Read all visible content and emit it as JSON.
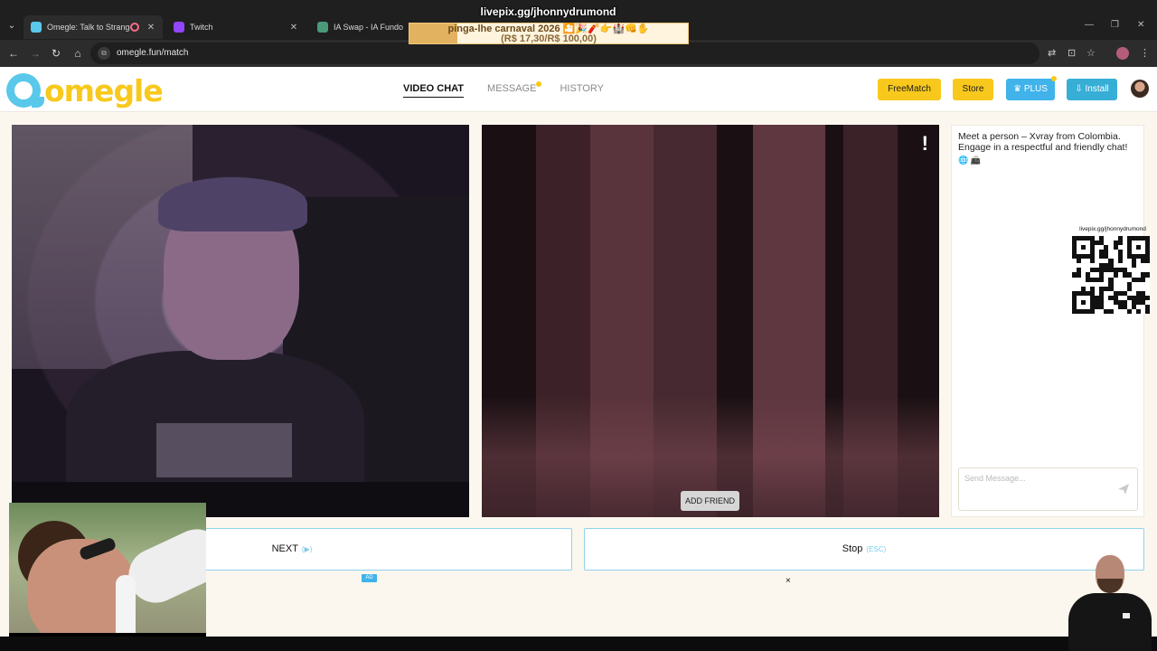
{
  "browser": {
    "tabs": [
      {
        "label": "Omegle: Talk to Strangers",
        "favicon_color": "#5ac8ea",
        "active": true,
        "recording": true
      },
      {
        "label": "Twitch",
        "favicon_color": "#9146ff",
        "active": false
      },
      {
        "label": "IA Swap - IA Fundo",
        "favicon_color": "#4a9a7a",
        "active": false
      }
    ],
    "url": "omegle.fun/match"
  },
  "stream_overlay": {
    "link": "livepix.gg/jhonnydrumond",
    "donation_title": "pinga-lhe carnaval 2026",
    "donation_emojis": "🎦🎉🧨👉🏰👊✋",
    "donation_amount": "(R$ 17,30/R$ 100,00)",
    "donation_progress": 0.173,
    "qr_label": "livepix.gg/jhonnydrumond"
  },
  "site": {
    "logo_text": "omegle",
    "nav": [
      {
        "label": "VIDEO CHAT",
        "active": true
      },
      {
        "label": "MESSAGE",
        "active": false,
        "has_dot": true
      },
      {
        "label": "HISTORY",
        "active": false
      }
    ],
    "buttons": {
      "freematch": "FreeMatch",
      "store": "Store",
      "plus": "PLUS",
      "plus_icon": "♛",
      "install": "Install",
      "install_icon": "⇩"
    }
  },
  "video": {
    "add_friend": "ADD FRIEND",
    "report_icon": "!"
  },
  "chat": {
    "intro": "Meet a person – Xvray from Colombia. Engage in a respectful and friendly chat!",
    "intro_icons": "🌐 📠",
    "placeholder": "Send Message..."
  },
  "controls": {
    "next_label": "NEXT",
    "next_hint": "(▶)",
    "stop_label": "Stop",
    "stop_hint": "(ESC)",
    "ad_label": "AD",
    "close_ad": "×"
  },
  "colors": {
    "brand_yellow": "#f8c91c",
    "brand_blue": "#3fb3ea",
    "page_bg": "#fbf7ee"
  }
}
